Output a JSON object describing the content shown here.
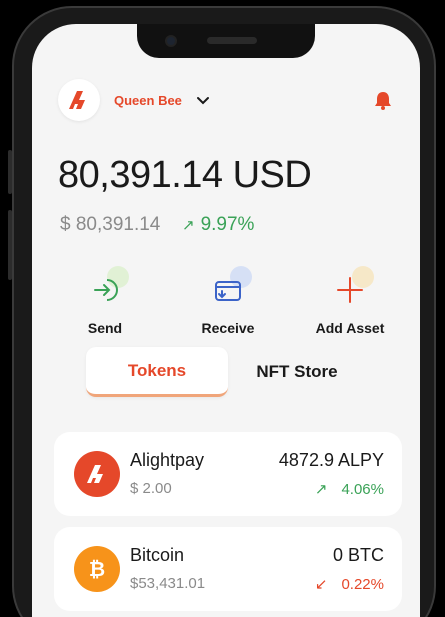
{
  "header": {
    "user_name": "Queen Bee",
    "logo_icon": "alightpay-logo-icon",
    "chevron_icon": "chevron-down-icon",
    "bell_icon": "bell-icon"
  },
  "balance": {
    "total": "80,391.14 USD",
    "sub": "$ 80,391.14",
    "change": "9.97%",
    "change_arrow": "↗"
  },
  "actions": [
    {
      "label": "Send",
      "icon": "send-icon",
      "color": "#3aa257",
      "blob": "#d8f0c8"
    },
    {
      "label": "Receive",
      "icon": "receive-icon",
      "color": "#3b63c8",
      "blob": "#c9d7f5"
    },
    {
      "label": "Add Asset",
      "icon": "plus-icon",
      "color": "#e5482a",
      "blob": "#f7e3b5"
    }
  ],
  "tabs": {
    "tokens": "Tokens",
    "nft": "NFT Store"
  },
  "tokens": [
    {
      "name": "Alightpay",
      "price": "$ 2.00",
      "amount": "4872.9 ALPY",
      "change": "4.06%",
      "arrow": "↗",
      "direction": "up",
      "coin_color": "#e5482a"
    },
    {
      "name": "Bitcoin",
      "price": "$53,431.01",
      "amount": "0 BTC",
      "change": "0.22%",
      "arrow": "↙",
      "direction": "down",
      "coin_color": "#f7931a"
    }
  ],
  "colors": {
    "accent": "#e5482a",
    "positive": "#3aa257",
    "negative": "#e5482a"
  }
}
